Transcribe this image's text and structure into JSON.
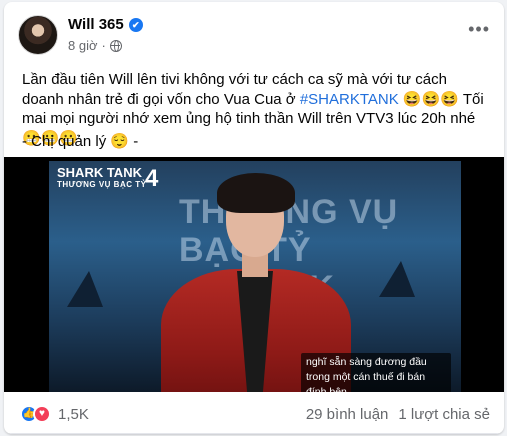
{
  "post": {
    "author": "Will 365",
    "verified_glyph": "✔",
    "timestamp": "8 giờ",
    "more_glyph": "•••",
    "text_part1": "Lần đầu tiên Will lên tivi không với tư cách ca sỹ mà với tư cách doanh nhân trẻ đi gọi vốn cho Vua Cua ở ",
    "hashtag": "#SHARKTANK",
    "text_part2": " 😆😆😆 Tối mai mọi người nhớ xem ủng hộ tinh thần Will trên VTV3 lúc 20h nhé 😬😬😬",
    "signature": "- Chị quản lý 😌 -"
  },
  "video": {
    "logo_line1": "SHARK TANK",
    "logo_line2": "THƯƠNG VỤ BẠC TỶ",
    "logo_number": "4",
    "backdrop_line1": "THƯƠNG VỤ BẠC TỶ",
    "backdrop_line2": "SHARK TANK",
    "subtitle": "nghĩ sẵn sàng đương đầu trong một cán thuế đi bán đính bên"
  },
  "footer": {
    "like_glyph": "👍",
    "love_glyph": "♥",
    "reaction_count": "1,5K",
    "comments": "29 bình luận",
    "shares": "1 lượt chia sẻ"
  },
  "colors": {
    "accent": "#1877f2",
    "hashtag": "#216fdb",
    "love": "#f33e58",
    "jacket": "#b42a24"
  }
}
